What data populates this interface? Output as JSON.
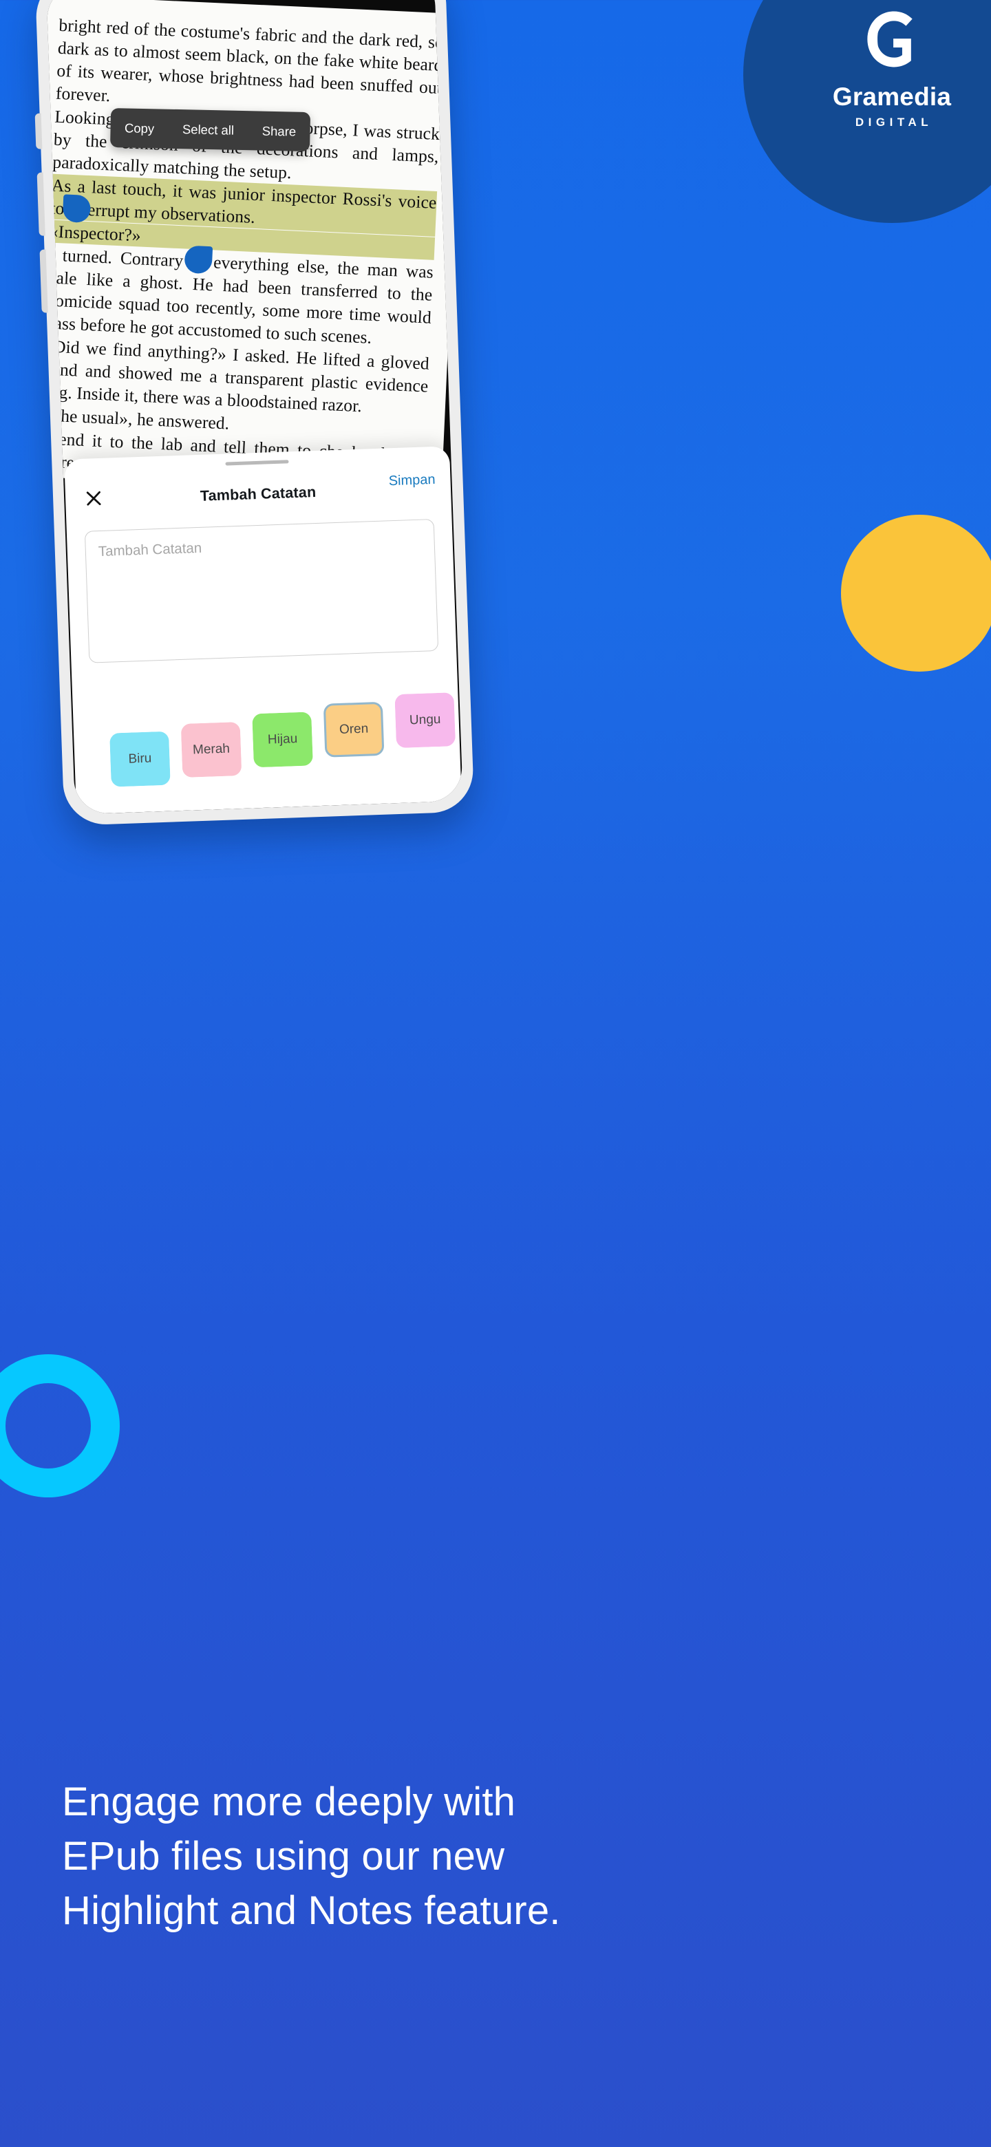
{
  "brand": {
    "logo_icon": "gramedia-g-icon",
    "name": "Gramedia",
    "subtitle": "DIGITAL",
    "badge_color": "#134A92"
  },
  "colors": {
    "background_top": "#1669E8",
    "background_bottom": "#2B4FCB",
    "accent_cyan": "#06C8FF",
    "accent_yellow": "#FAC43A",
    "highlight_olive": "#CFD28D",
    "highlight_blue": "#BFE2F2",
    "selection_handle": "#1565C0",
    "save_link": "#1A7BBF"
  },
  "reader": {
    "paragraphs": [
      "bright red of the costume's fabric and the dark red, so dark as to almost seem black, on the fake white beard of its wearer, whose brightness had been snuffed out forever.",
      "Looking up from the disarranged corpse, I was struck by the crimson of the decorations and lamps, paradoxically matching the setup.",
      "As a last touch, it was junior inspector Rossi's voice to interrupt my observations.",
      "«Inspector?»",
      "I turned. Contrary to everything else, the man was pale like a ghost. He had been transferred to the homicide squad too recently, some more time would pass before he got accustomed to such scenes.",
      "«Did we find anything?» I asked. He lifted a gloved hand and showed me a transparent plastic evidence bag. Inside it, there was a bloodstained razor.",
      "«The usual», he answered.",
      "«Send it to the lab and tell them to check whether there are prints or anything», I told him, already knowing that they would"
    ],
    "highlighted_text": "matching the setup. As a last touch, it was junior inspector Rossi's voice to interrupt my observations. «Inspector?»"
  },
  "context_menu": {
    "items": [
      {
        "label": "Copy",
        "name": "copy"
      },
      {
        "label": "Select all",
        "name": "select-all"
      },
      {
        "label": "Share",
        "name": "share"
      }
    ]
  },
  "note_sheet": {
    "title": "Tambah Catatan",
    "save_label": "Simpan",
    "close_icon": "close-x-icon",
    "input_value": "",
    "input_placeholder": "Tambah Catatan",
    "color_chips": [
      {
        "label": "Biru",
        "hex": "#7FE3F6",
        "selected": false
      },
      {
        "label": "Merah",
        "hex": "#FBC2CF",
        "selected": false
      },
      {
        "label": "Hijau",
        "hex": "#8CE86B",
        "selected": false
      },
      {
        "label": "Oren",
        "hex": "#FBCE85",
        "selected": true
      },
      {
        "label": "Ungu",
        "hex": "#F7B9EC",
        "selected": false
      }
    ]
  },
  "caption": {
    "line1": "Engage more deeply with",
    "line2": "EPub files using our new",
    "line3": "Highlight and Notes feature."
  }
}
